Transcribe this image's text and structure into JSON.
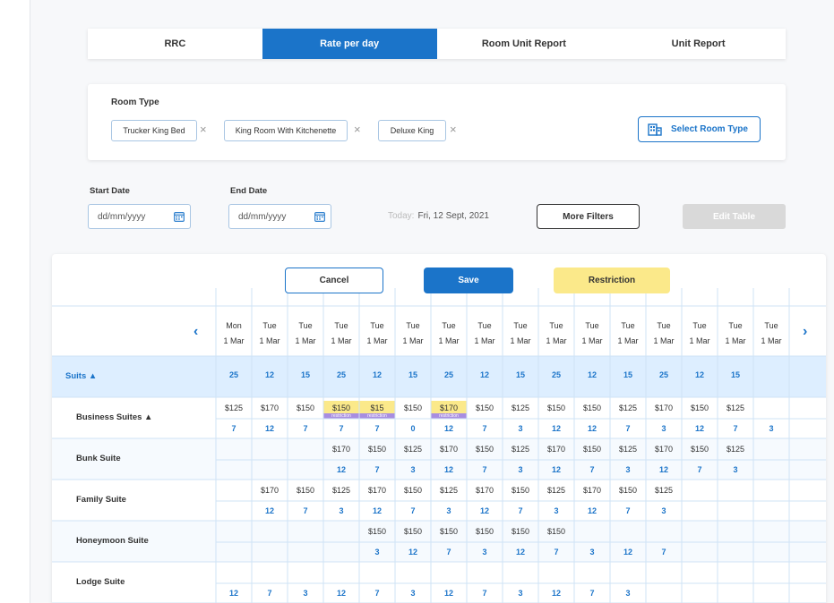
{
  "tabs": [
    "RRC",
    "Rate per day",
    "Room Unit Report",
    "Unit Report"
  ],
  "active_tab": 1,
  "room_type": {
    "label": "Room Type",
    "chips": [
      "Trucker King Bed",
      "King Room With Kitchenette",
      "Deluxe King"
    ],
    "remove_glyph": "×",
    "select_button": "Select Room Type"
  },
  "filters": {
    "start_label": "Start Date",
    "end_label": "End Date",
    "date_placeholder": "dd/mm/yyyy",
    "today_label": "Today:",
    "today_value": "Fri, 12 Sept, 2021",
    "more_filters": "More Filters",
    "edit_table": "Edit Table"
  },
  "actions": {
    "cancel": "Cancel",
    "save": "Save",
    "restriction": "Restriction"
  },
  "colors": {
    "accent": "#1b74c9",
    "restriction": "#fbe98a",
    "restriction_tag": "#a88ee0",
    "suits_row": "#ddeeff"
  },
  "days": [
    {
      "day": "Mon",
      "date": "1 Mar"
    },
    {
      "day": "Tue",
      "date": "1 Mar"
    },
    {
      "day": "Tue",
      "date": "1 Mar"
    },
    {
      "day": "Tue",
      "date": "1 Mar"
    },
    {
      "day": "Tue",
      "date": "1 Mar"
    },
    {
      "day": "Tue",
      "date": "1 Mar"
    },
    {
      "day": "Tue",
      "date": "1 Mar"
    },
    {
      "day": "Tue",
      "date": "1 Mar"
    },
    {
      "day": "Tue",
      "date": "1 Mar"
    },
    {
      "day": "Tue",
      "date": "1 Mar"
    },
    {
      "day": "Tue",
      "date": "1 Mar"
    },
    {
      "day": "Tue",
      "date": "1 Mar"
    },
    {
      "day": "Tue",
      "date": "1 Mar"
    },
    {
      "day": "Tue",
      "date": "1 Mar"
    },
    {
      "day": "Tue",
      "date": "1 Mar"
    },
    {
      "day": "Tue",
      "date": "1 Mar"
    }
  ],
  "suits": {
    "label": "Suits",
    "totals": [
      "25",
      "12",
      "15",
      "25",
      "12",
      "15",
      "25",
      "12",
      "15",
      "25",
      "12",
      "15",
      "25",
      "12",
      "15",
      ""
    ]
  },
  "restriction_tag": "restriction",
  "rows": [
    {
      "label": "Business Suites",
      "expandable": true,
      "prices": [
        "$125",
        "$170",
        "$150",
        "$150",
        "$15",
        "$150",
        "$170",
        "$150",
        "$125",
        "$150",
        "$150",
        "$125",
        "$170",
        "$150",
        "$125",
        ""
      ],
      "units": [
        "7",
        "12",
        "7",
        "7",
        "7",
        "0",
        "12",
        "7",
        "3",
        "12",
        "12",
        "7",
        "3",
        "12",
        "7",
        "3"
      ],
      "restricted": [
        3,
        4,
        6
      ]
    },
    {
      "label": "Bunk Suite",
      "expandable": false,
      "prices": [
        "",
        "",
        "",
        "$170",
        "$150",
        "$125",
        "$170",
        "$150",
        "$125",
        "$170",
        "$150",
        "$125",
        "$170",
        "$150",
        "$125",
        ""
      ],
      "units": [
        "",
        "",
        "",
        "12",
        "7",
        "3",
        "12",
        "7",
        "3",
        "12",
        "7",
        "3",
        "12",
        "7",
        "3",
        ""
      ],
      "restricted": []
    },
    {
      "label": "Family Suite",
      "expandable": false,
      "prices": [
        "",
        "$170",
        "$150",
        "$125",
        "$170",
        "$150",
        "$125",
        "$170",
        "$150",
        "$125",
        "$170",
        "$150",
        "$125",
        "",
        "",
        ""
      ],
      "units": [
        "",
        "12",
        "7",
        "3",
        "12",
        "7",
        "3",
        "12",
        "7",
        "3",
        "12",
        "7",
        "3",
        "",
        "",
        ""
      ],
      "restricted": []
    },
    {
      "label": "Honeymoon Suite",
      "expandable": false,
      "prices": [
        "",
        "",
        "",
        "",
        "$150",
        "$150",
        "$150",
        "$150",
        "$150",
        "$150",
        "",
        "",
        "",
        "",
        "",
        ""
      ],
      "units": [
        "",
        "",
        "",
        "",
        "3",
        "12",
        "7",
        "3",
        "12",
        "7",
        "3",
        "12",
        "7",
        "",
        "",
        ""
      ],
      "restricted": []
    },
    {
      "label": "Lodge Suite",
      "expandable": false,
      "prices": [
        "",
        "",
        "",
        "",
        "",
        "",
        "",
        "",
        "",
        "",
        "",
        "",
        "",
        "",
        "",
        ""
      ],
      "units": [
        "12",
        "7",
        "3",
        "12",
        "7",
        "3",
        "12",
        "7",
        "3",
        "12",
        "7",
        "3",
        "",
        "",
        "",
        ""
      ],
      "restricted": []
    }
  ]
}
